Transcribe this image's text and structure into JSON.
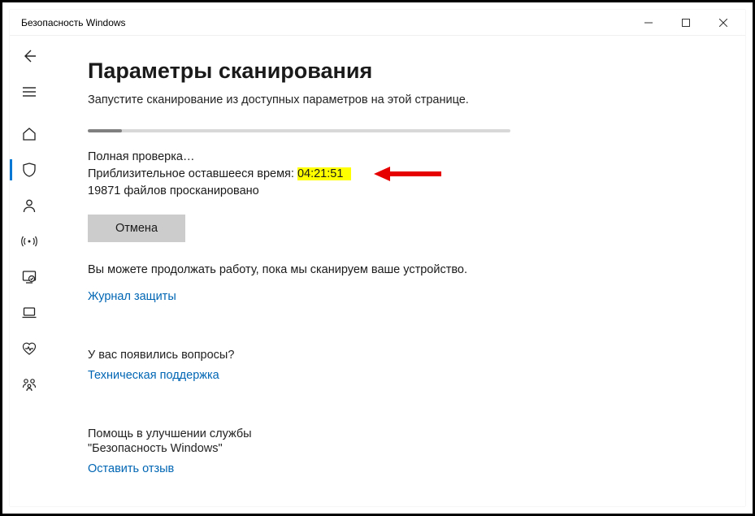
{
  "window": {
    "title": "Безопасность Windows"
  },
  "page": {
    "title": "Параметры сканирования",
    "subtitle": "Запустите сканирование из доступных параметров на этой странице."
  },
  "scan": {
    "status": "Полная проверка…",
    "time_label": "Приблизительное оставшееся время: ",
    "time_value": "04:21:51",
    "files_count": "19871",
    "files_suffix": " файлов просканировано",
    "cancel": "Отмена",
    "note": "Вы можете продолжать работу, пока мы сканируем ваше устройство.",
    "history_link": "Журнал защиты"
  },
  "help": {
    "heading": "У вас появились вопросы?",
    "link": "Техническая поддержка"
  },
  "feedback": {
    "heading1": "Помощь в улучшении службы",
    "heading2": "\"Безопасность Windows\"",
    "link": "Оставить отзыв"
  }
}
